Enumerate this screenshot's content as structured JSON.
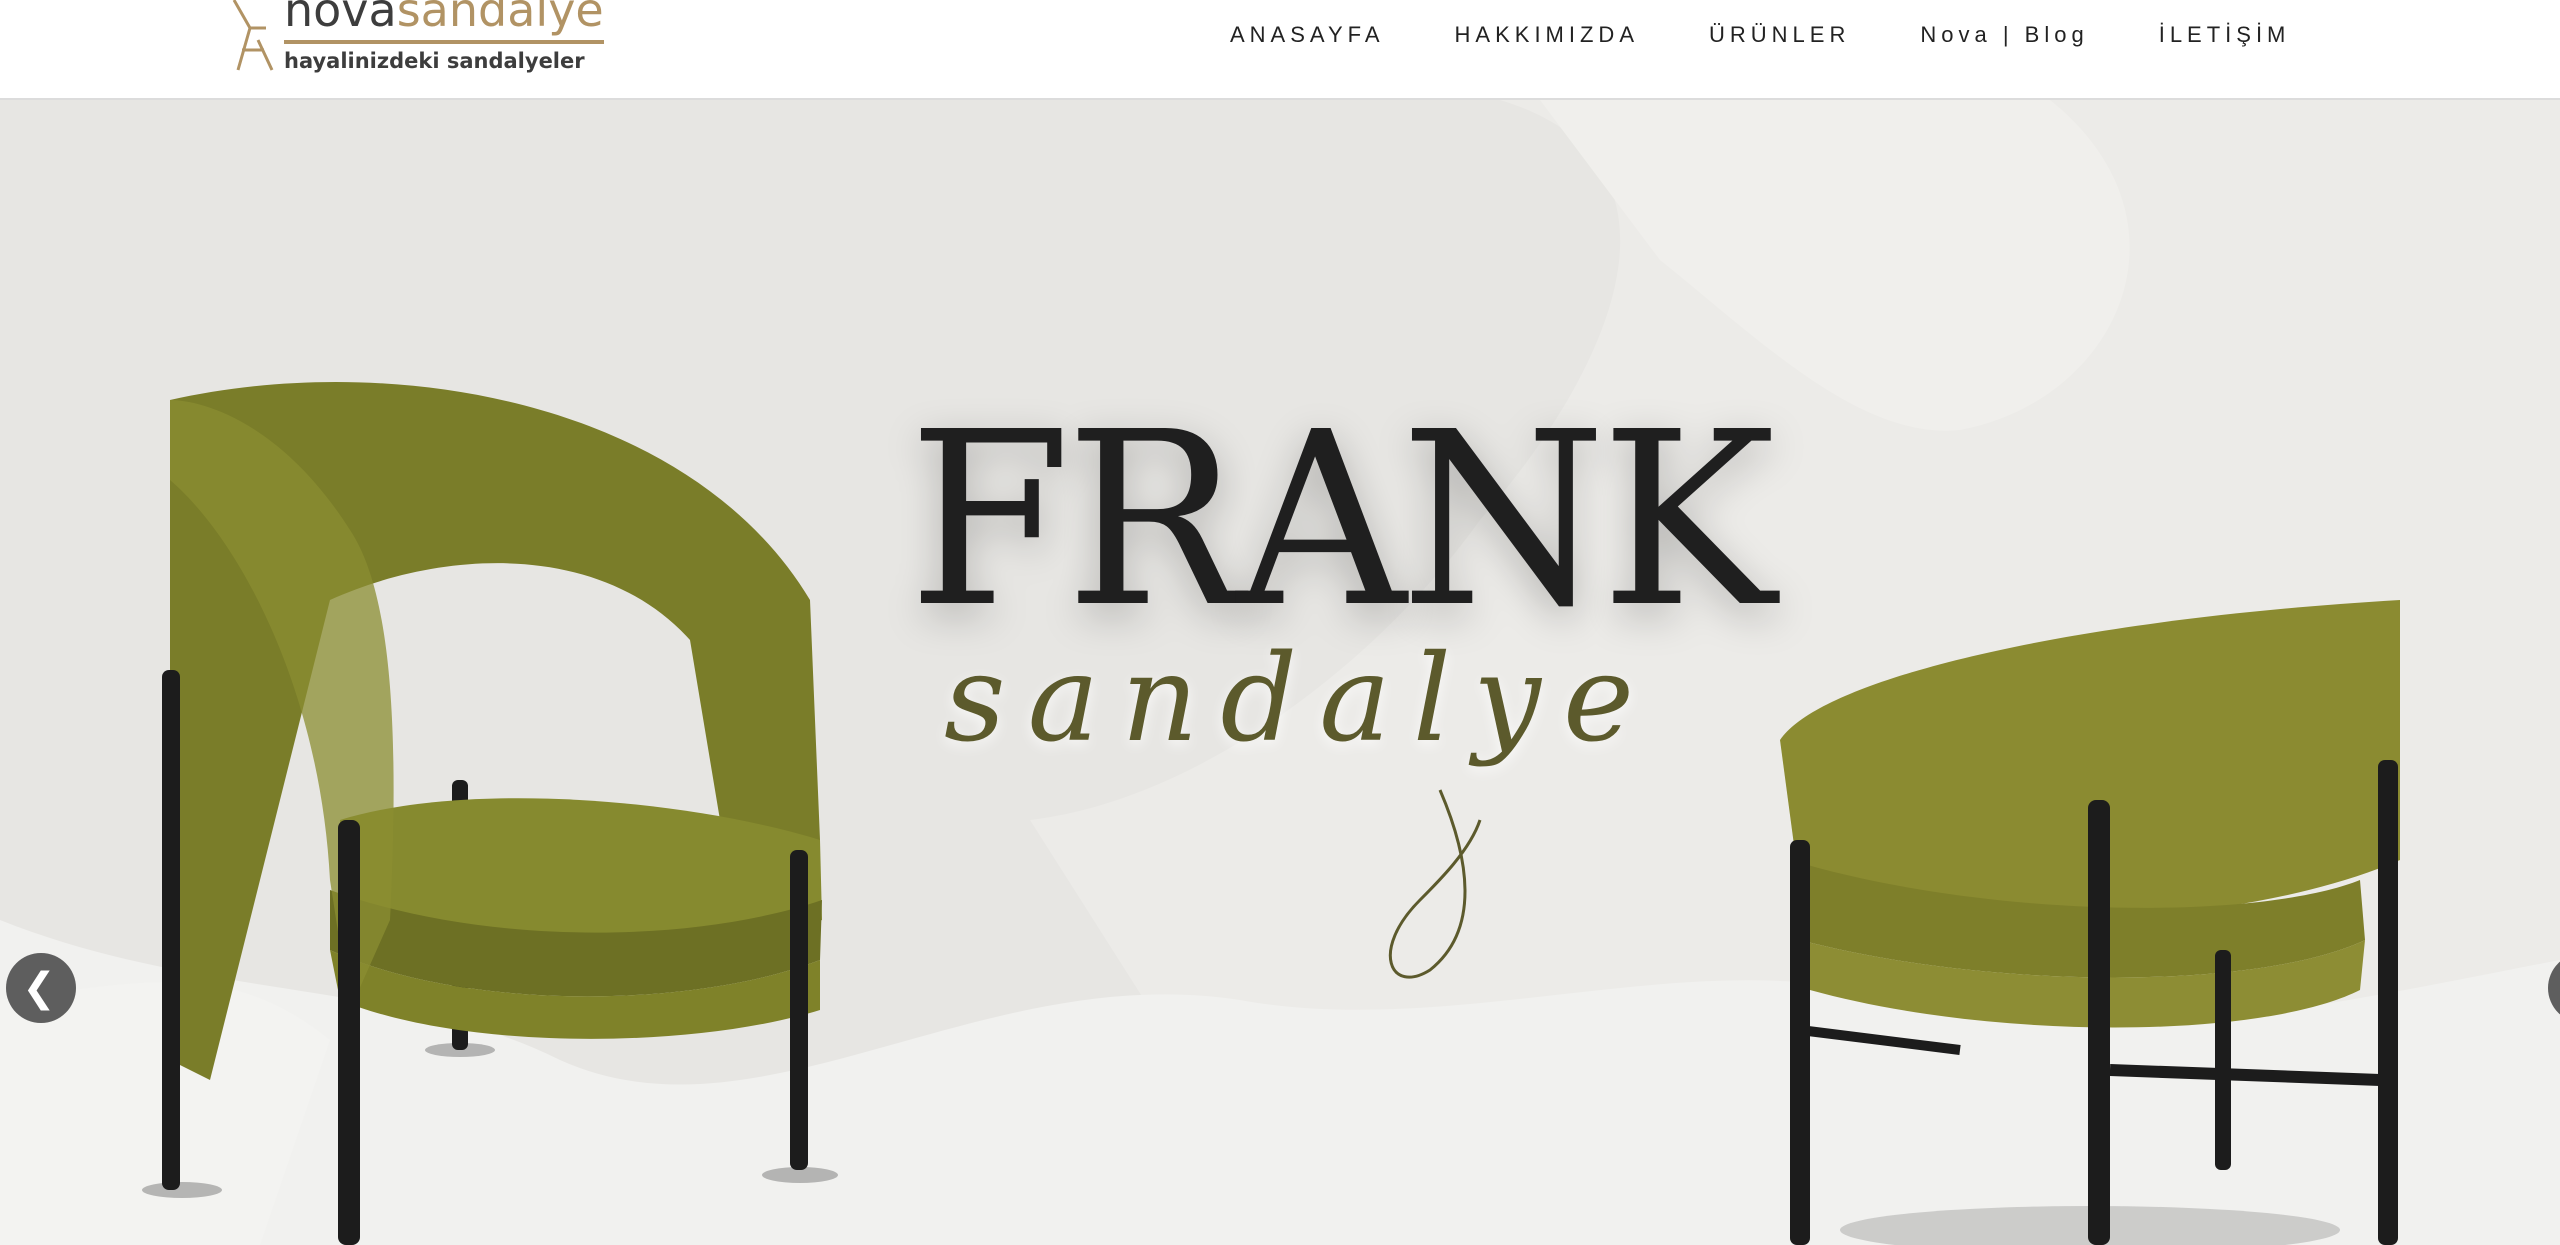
{
  "brand": {
    "name_part1": "nova",
    "name_part2": "sandalye",
    "tagline": "hayalinizdeki sandalyeler",
    "colors": {
      "dark": "#3d3d3d",
      "gold": "#b19364"
    }
  },
  "nav": {
    "items": [
      {
        "label": "ANASAYFA"
      },
      {
        "label": "HAKKIMIZDA"
      },
      {
        "label": "ÜRÜNLER"
      },
      {
        "label": "Nova | Blog"
      },
      {
        "label": "İLETİŞİM"
      }
    ]
  },
  "hero": {
    "title": "FRANK",
    "subtitle": "sandalye",
    "colors": {
      "chair": "#7d7f2b",
      "legs": "#1c1c1c",
      "background": "#e7e6e3",
      "subtitle": "#5c5a2c"
    },
    "controls": {
      "prev_icon": "chevron-left-icon",
      "next_icon": "chevron-right-icon"
    }
  }
}
